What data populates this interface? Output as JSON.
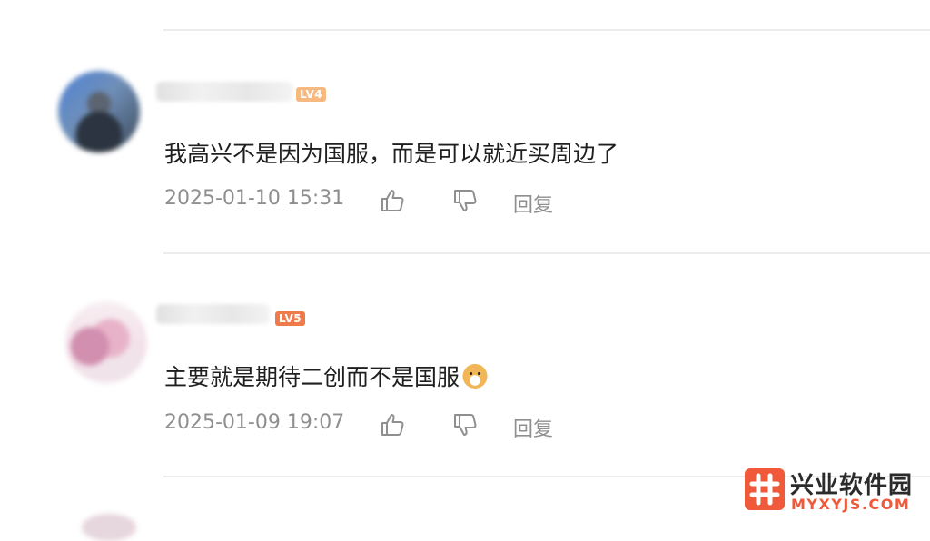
{
  "comments": [
    {
      "level": "LV4",
      "text": "我高兴不是因为国服，而是可以就近买周边了",
      "time": "2025-01-10 15:31",
      "reply_label": "回复",
      "level_color": "#f6b97f"
    },
    {
      "level": "LV5",
      "text": "主要就是期待二创而不是国服",
      "emoji": "doge-emoji",
      "time": "2025-01-09 19:07",
      "reply_label": "回复",
      "level_color": "#ef7a4a"
    }
  ],
  "icons": {
    "like": "thumbs-up-icon",
    "dislike": "thumbs-down-icon"
  },
  "watermark": {
    "title": "兴业软件园",
    "url": "MYXYJS.COM",
    "accent": "#f05a3b"
  }
}
